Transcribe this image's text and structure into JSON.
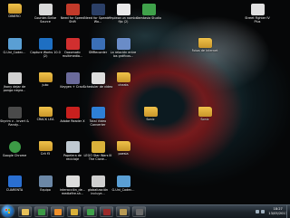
{
  "desktop_icons": [
    {
      "label": "DINERO",
      "kind": "folder",
      "color": "#f0c24a"
    },
    {
      "label": "Counter-Strike Source",
      "kind": "app",
      "color": "#d9d9d9"
    },
    {
      "label": "Need for Speed Shift",
      "kind": "app",
      "color": "#c23a2a"
    },
    {
      "label": "Need for Speed™ Wo...",
      "kind": "app",
      "color": "#2b3f66"
    },
    {
      "label": "empieza un nombre fijo (2)",
      "kind": "doc",
      "color": "#e8e8e8"
    },
    {
      "label": "Camtasia Studio",
      "kind": "app",
      "color": "#3fa14a"
    },
    {
      "label": "Street Fighter IV Plus",
      "kind": "app",
      "color": "#e0e0e0"
    },
    {
      "label": "G-Uni_Codec...",
      "kind": "app",
      "color": "#5a9fd4"
    },
    {
      "label": "Capture Works 10.0 (2)",
      "kind": "app",
      "color": "#1e6fc2"
    },
    {
      "label": "Oozomatic multimedia...",
      "kind": "app",
      "color": "#d12f2f"
    },
    {
      "label": "SMRecorder",
      "kind": "app",
      "color": "#3b6fb6"
    },
    {
      "label": "La relación entre los gráficos...",
      "kind": "doc",
      "color": "#6a8cc7"
    },
    {
      "label": "Fotos de internet",
      "kind": "folder",
      "color": "#f0c24a"
    },
    {
      "label": "Jhony dejar de ponga negra...",
      "kind": "doc",
      "color": "#d0d0d0"
    },
    {
      "label": "juko",
      "kind": "folder",
      "color": "#f0c24a"
    },
    {
      "label": "Keygen + Crack",
      "kind": "app",
      "color": "#6a6a9a"
    },
    {
      "label": "Scheduler de video",
      "kind": "app",
      "color": "#dddddd"
    },
    {
      "label": "cheats",
      "kind": "folder",
      "color": "#f0c24a"
    },
    {
      "label": "Skyrim v - invert & Randy...",
      "kind": "app",
      "color": "#4a4a4a"
    },
    {
      "label": "CRACK LEA",
      "kind": "folder",
      "color": "#f0c24a"
    },
    {
      "label": "Adobe Reader X",
      "kind": "app",
      "color": "#c8201e"
    },
    {
      "label": "Total Video Converter",
      "kind": "app",
      "color": "#2e7fd6"
    },
    {
      "label": "Sonic",
      "kind": "folder",
      "color": "#f0c24a"
    },
    {
      "label": "Sonic",
      "kind": "folder",
      "color": "#f0c24a"
    },
    {
      "label": "Google Chrome",
      "kind": "round",
      "color": "#3c9a46"
    },
    {
      "label": "Crit f5",
      "kind": "folder",
      "color": "#f0c24a"
    },
    {
      "label": "Papelera de reciclaje",
      "kind": "app",
      "color": "#bfc9d1"
    },
    {
      "label": "LEGO Star Wars III The Clone...",
      "kind": "app",
      "color": "#d9b13a"
    },
    {
      "label": "poesia",
      "kind": "folder",
      "color": "#f0c24a"
    },
    {
      "label": "CUARENTA",
      "kind": "app",
      "color": "#2a6fd1"
    },
    {
      "label": "Equipo",
      "kind": "app",
      "color": "#6b87a6"
    },
    {
      "label": "interacción_de... mediafire.sh...",
      "kind": "doc",
      "color": "#dcdcdc"
    },
    {
      "label": "globalización incluye...",
      "kind": "doc",
      "color": "#cfcfcf"
    },
    {
      "label": "G-Uni_Codec...",
      "kind": "app",
      "color": "#5a9fd4"
    }
  ],
  "taskbar": {
    "start_label": "Start",
    "pinned": [
      {
        "name": "explorer",
        "color": "#e8c25a"
      },
      {
        "name": "chrome",
        "color": "#3c9a46"
      },
      {
        "name": "media-player",
        "color": "#f0902a"
      },
      {
        "name": "folder",
        "color": "#d9b13a"
      },
      {
        "name": "camtasia",
        "color": "#3fa14a"
      },
      {
        "name": "video-app",
        "color": "#9a2a2a"
      },
      {
        "name": "files",
        "color": "#b89a55"
      },
      {
        "name": "misc",
        "color": "#6a6a6a"
      }
    ],
    "clock_time": "18:27",
    "clock_date": "13/05/2013"
  }
}
